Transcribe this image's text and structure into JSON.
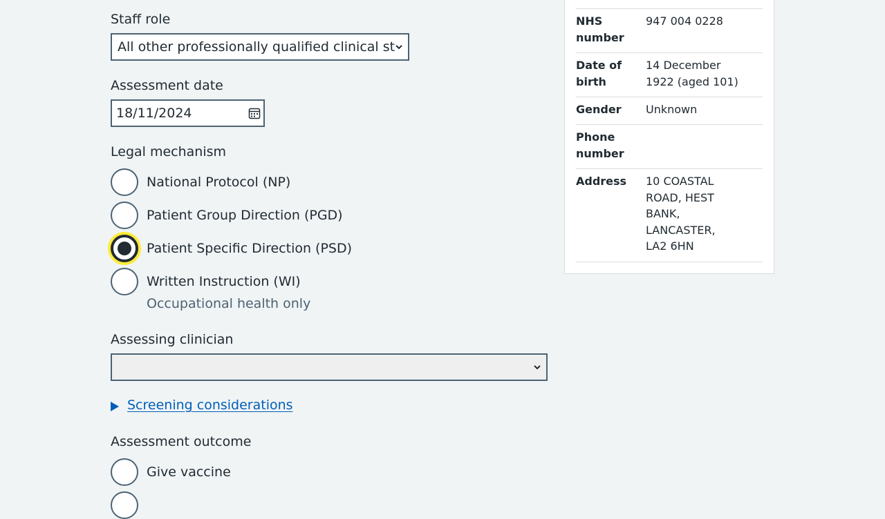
{
  "form": {
    "staff_role": {
      "label": "Staff role",
      "selected": "All other professionally qualified clinical staff"
    },
    "assessment_date": {
      "label": "Assessment date",
      "value": "18/11/2024"
    },
    "legal_mechanism": {
      "label": "Legal mechanism",
      "options": [
        {
          "label": "National Protocol (NP)",
          "checked": false
        },
        {
          "label": "Patient Group Direction (PGD)",
          "checked": false
        },
        {
          "label": "Patient Specific Direction (PSD)",
          "checked": true
        },
        {
          "label": "Written Instruction (WI)",
          "checked": false,
          "hint": "Occupational health only"
        }
      ]
    },
    "assessing_clinician": {
      "label": "Assessing clinician",
      "selected": ""
    },
    "screening_link": "Screening considerations",
    "assessment_outcome": {
      "label": "Assessment outcome",
      "options": [
        {
          "label": "Give vaccine",
          "checked": false
        }
      ]
    }
  },
  "patient_summary": {
    "rows": [
      {
        "key": "NHS number",
        "value": "947 004 0228"
      },
      {
        "key": "Date of birth",
        "value": "14 December 1922 (aged 101)"
      },
      {
        "key": "Gender",
        "value": "Unknown"
      },
      {
        "key": "Phone number",
        "value": ""
      },
      {
        "key": "Address",
        "value": "10 COASTAL ROAD, HEST BANK, LANCASTER, LA2 6HN"
      }
    ]
  },
  "colors": {
    "background": "#f0f4f5",
    "text": "#212b32",
    "link": "#005eb8",
    "focus": "#ffeb3b",
    "border": "#4c6272"
  }
}
